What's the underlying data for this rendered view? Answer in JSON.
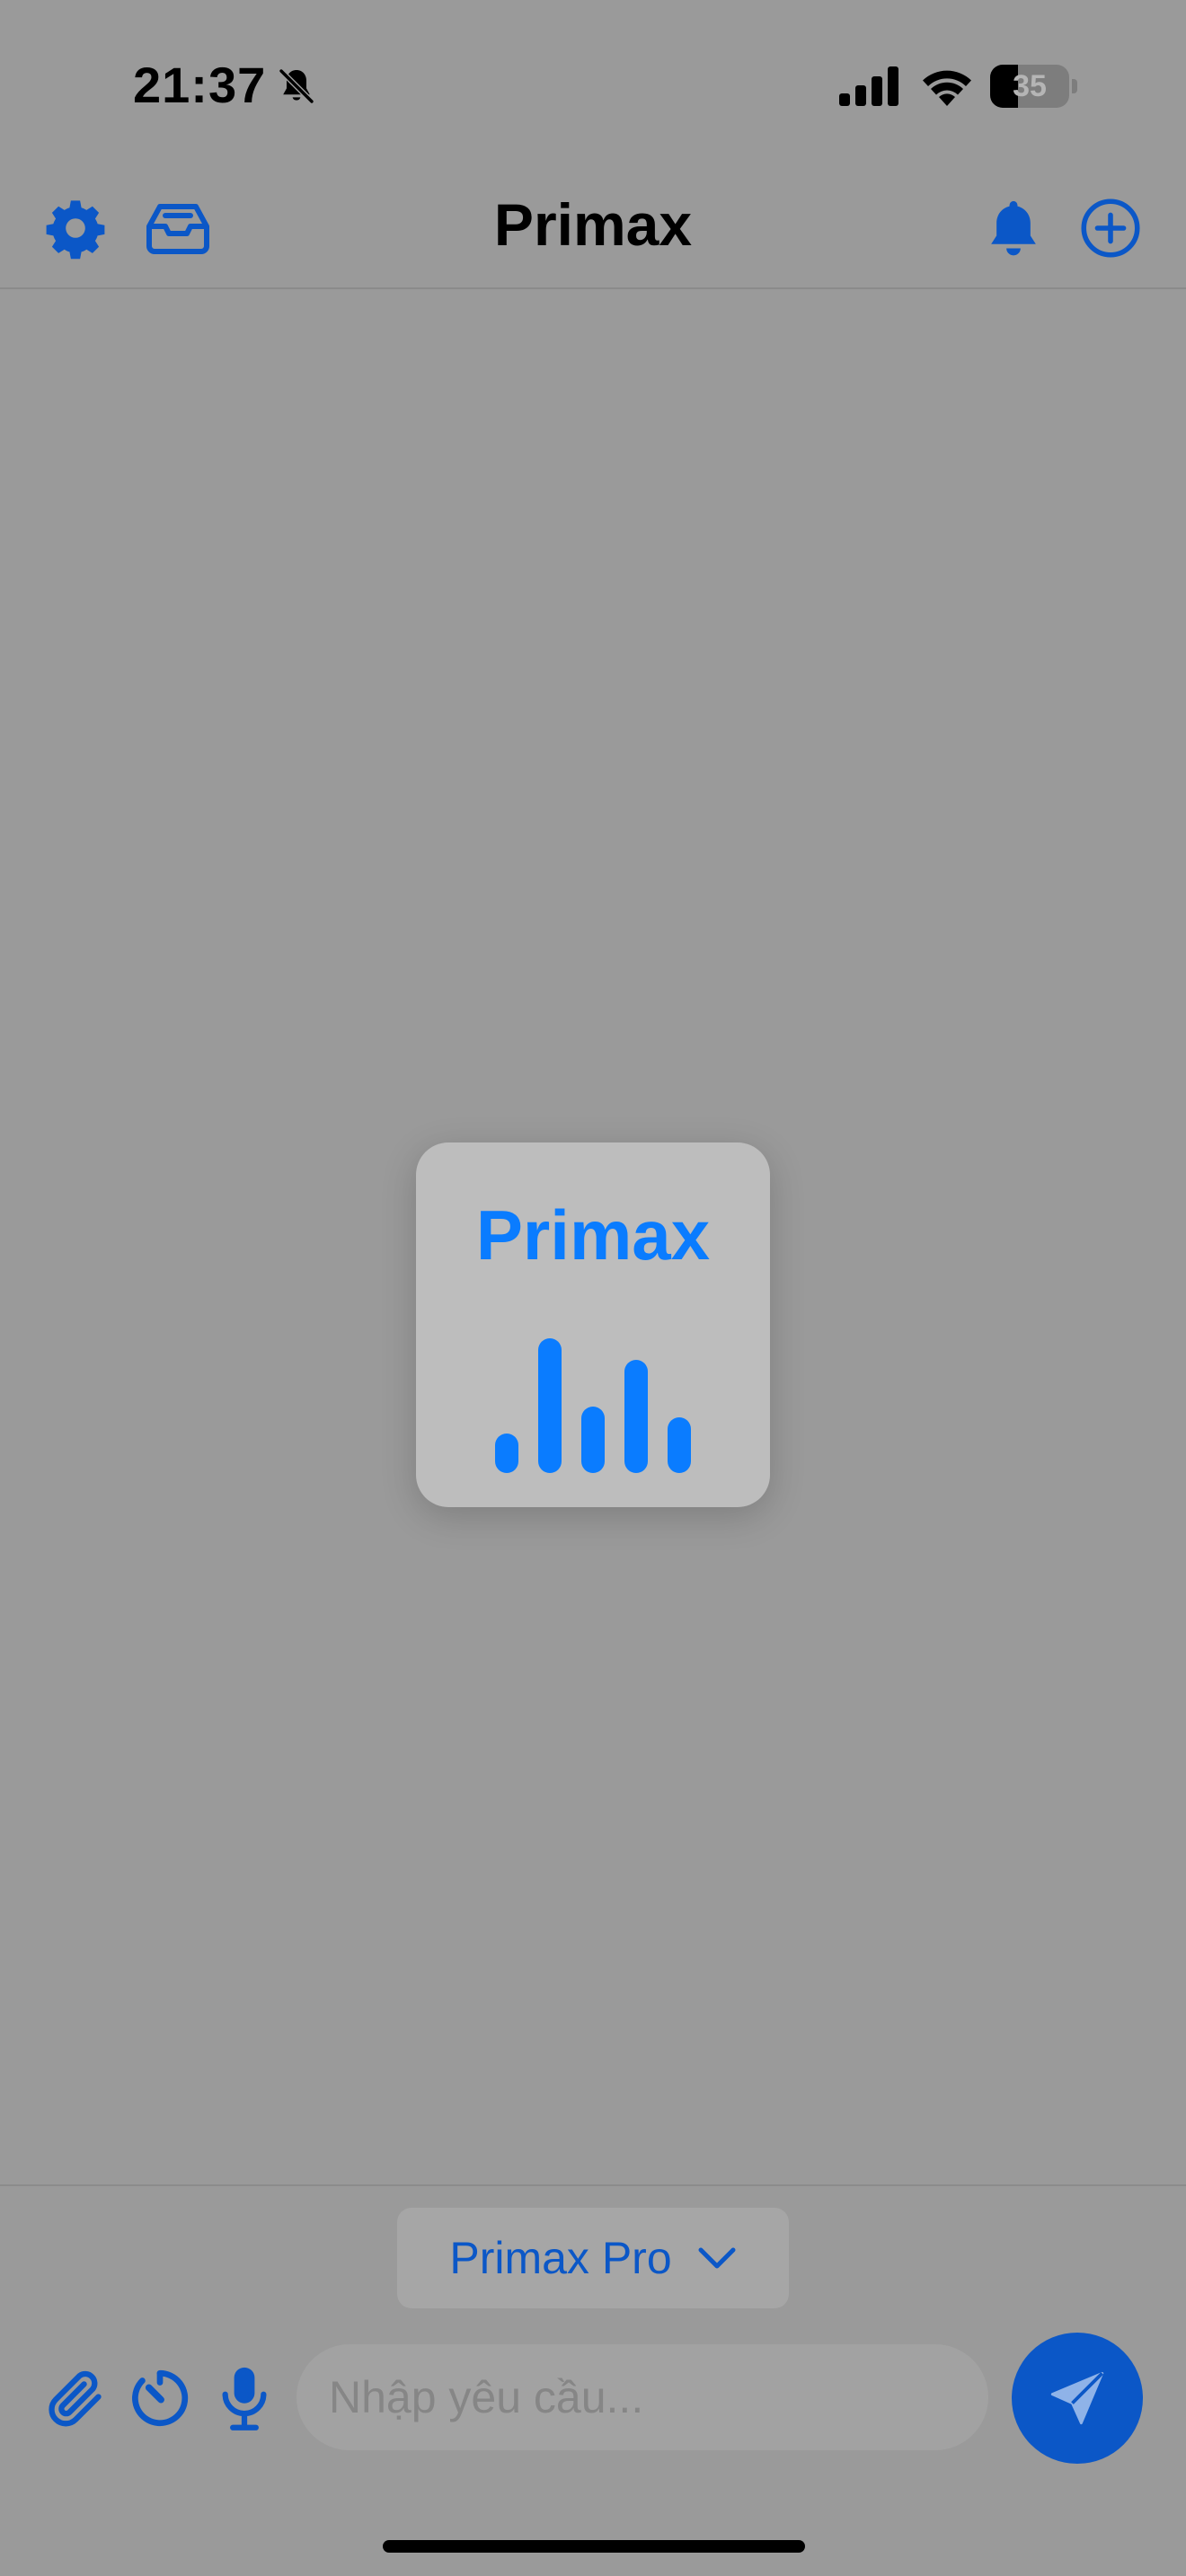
{
  "status_bar": {
    "time": "21:37",
    "battery_level": "35",
    "battery_fraction": 0.35,
    "icons": [
      "bell-slash-icon",
      "cellular-signal-icon",
      "wifi-icon",
      "battery-icon"
    ]
  },
  "nav": {
    "title": "Primax",
    "left_icons": [
      "gear-icon",
      "inbox-tray-icon"
    ],
    "right_icons": [
      "bell-icon",
      "plus-circle-icon"
    ]
  },
  "loader": {
    "title": "Primax",
    "icon": "audio-bars-icon"
  },
  "composer": {
    "model_label": "Primax Pro",
    "input_placeholder": "Nhập yêu cầu...",
    "tool_icons": [
      "paperclip-icon",
      "timer-icon",
      "microphone-icon"
    ],
    "send_icon": "paper-plane-icon"
  },
  "colors": {
    "background": "#9a9a9a",
    "accent": "#0b57c7",
    "loader_accent": "#0a7cff"
  }
}
